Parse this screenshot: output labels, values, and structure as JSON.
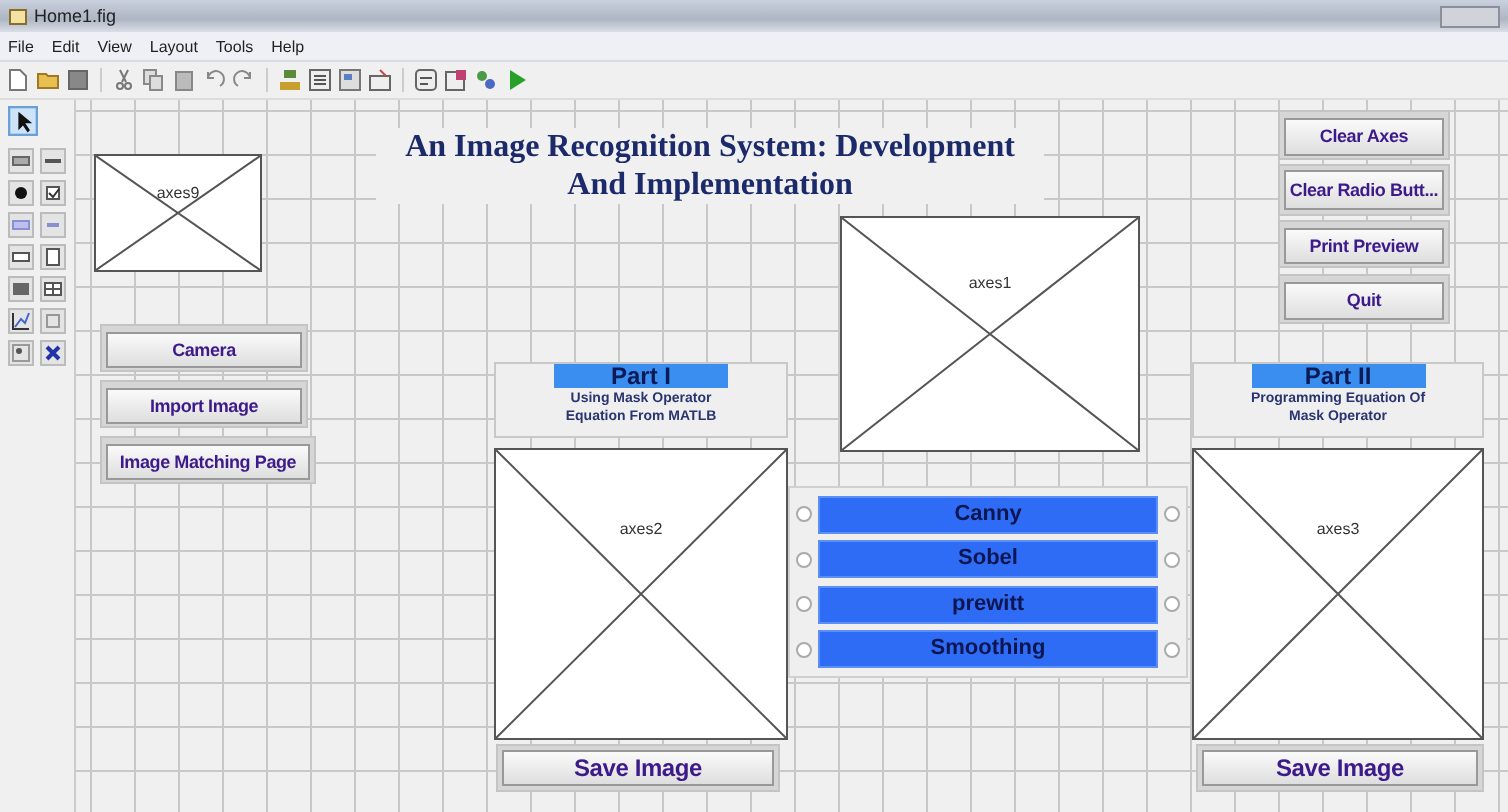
{
  "window": {
    "title": "Home1.fig"
  },
  "menu": [
    "File",
    "Edit",
    "View",
    "Layout",
    "Tools",
    "Help"
  ],
  "components": [
    {
      "kind": "axes",
      "label": "axes9"
    },
    {
      "kind": "button",
      "label": "Camera"
    },
    {
      "kind": "button",
      "label": "Import Image"
    },
    {
      "kind": "button",
      "label": "Image Matching Page"
    },
    {
      "kind": "title",
      "text": "An Image Recognition System: Development And Implementation"
    },
    {
      "kind": "axes",
      "label": "axes1"
    },
    {
      "kind": "button",
      "label": "Clear Axes"
    },
    {
      "kind": "button",
      "label": "Clear Radio Butt..."
    },
    {
      "kind": "button",
      "label": "Print Preview"
    },
    {
      "kind": "button",
      "label": "Quit"
    },
    {
      "kind": "panel",
      "heading": "Part I",
      "text": "Using Mask Operator Equation From MATLB"
    },
    {
      "kind": "panel",
      "heading": "Part II",
      "text": "Programming Equation Of Mask Operator"
    },
    {
      "kind": "axes",
      "label": "axes2"
    },
    {
      "kind": "axes",
      "label": "axes3"
    },
    {
      "kind": "radio_group",
      "options": [
        {
          "label": "Canny",
          "selected": false,
          "right_selected": false
        },
        {
          "label": "Sobel",
          "selected": false,
          "right_selected": false
        },
        {
          "label": "prewitt",
          "selected": false,
          "right_selected": false
        },
        {
          "label": "Smoothing",
          "selected": false,
          "right_selected": false
        }
      ]
    },
    {
      "kind": "button",
      "label": "Save Image"
    },
    {
      "kind": "button",
      "label": "Save Image"
    }
  ]
}
